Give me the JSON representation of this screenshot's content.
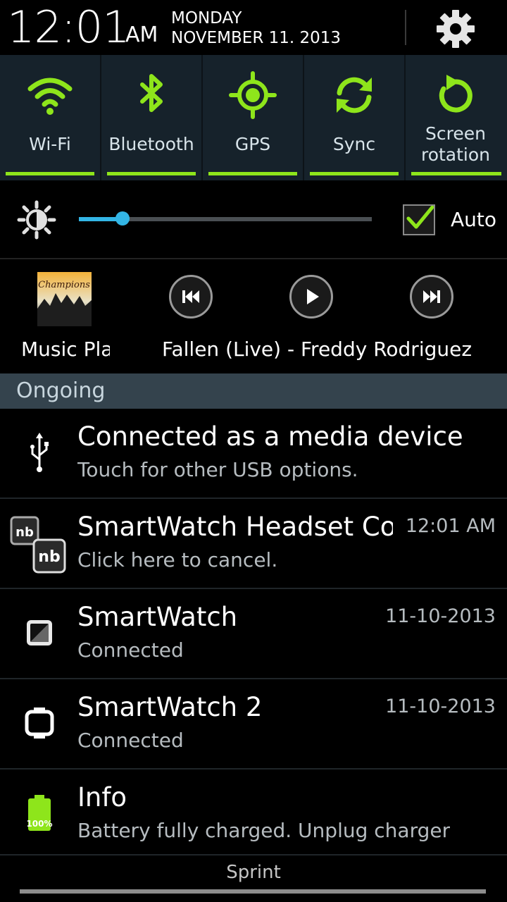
{
  "header": {
    "time": "12:01",
    "ampm": "AM",
    "day": "MONDAY",
    "date": "NOVEMBER 11. 2013",
    "settings_icon": "gear-icon"
  },
  "quick_toggles": [
    {
      "label": "Wi-Fi",
      "icon": "wifi-icon",
      "on": true
    },
    {
      "label": "Bluetooth",
      "icon": "bluetooth-icon",
      "on": true
    },
    {
      "label": "GPS",
      "icon": "gps-icon",
      "on": true
    },
    {
      "label": "Sync",
      "icon": "sync-icon",
      "on": true
    },
    {
      "label": "Screen rotation",
      "label_line1": "Screen",
      "label_line2": "rotation",
      "icon": "rotation-icon",
      "on": true
    }
  ],
  "brightness": {
    "level": 0.15,
    "auto_label": "Auto",
    "auto_checked": true
  },
  "music": {
    "app_label": "Music Player",
    "album_art_text": "Champions",
    "song": "Fallen (Live) - Freddy Rodriguez"
  },
  "ongoing_label": "Ongoing",
  "notifications": [
    {
      "icon": "usb-icon",
      "title": "Connected as a media device",
      "subtitle": "Touch for other USB options.",
      "time": ""
    },
    {
      "icon": "smartwatch-headset-icon",
      "title": "SmartWatch Headset Con",
      "subtitle": "Click here to cancel.",
      "time": "12:01 AM"
    },
    {
      "icon": "smartwatch-icon",
      "title": "SmartWatch",
      "subtitle": "Connected",
      "time": "11-10-2013"
    },
    {
      "icon": "smartwatch2-icon",
      "title": "SmartWatch 2",
      "subtitle": "Connected",
      "time": "11-10-2013"
    },
    {
      "icon": "battery-icon",
      "title": "Info",
      "subtitle": "Battery fully charged. Unplug charger",
      "time": "",
      "battery_text": "100%"
    }
  ],
  "carrier": "Sprint",
  "colors": {
    "toggle_on": "#8ee51b",
    "toggle_bg": "#16222b",
    "slider": "#33b5e5",
    "ongoing_bg": "#34434d"
  }
}
